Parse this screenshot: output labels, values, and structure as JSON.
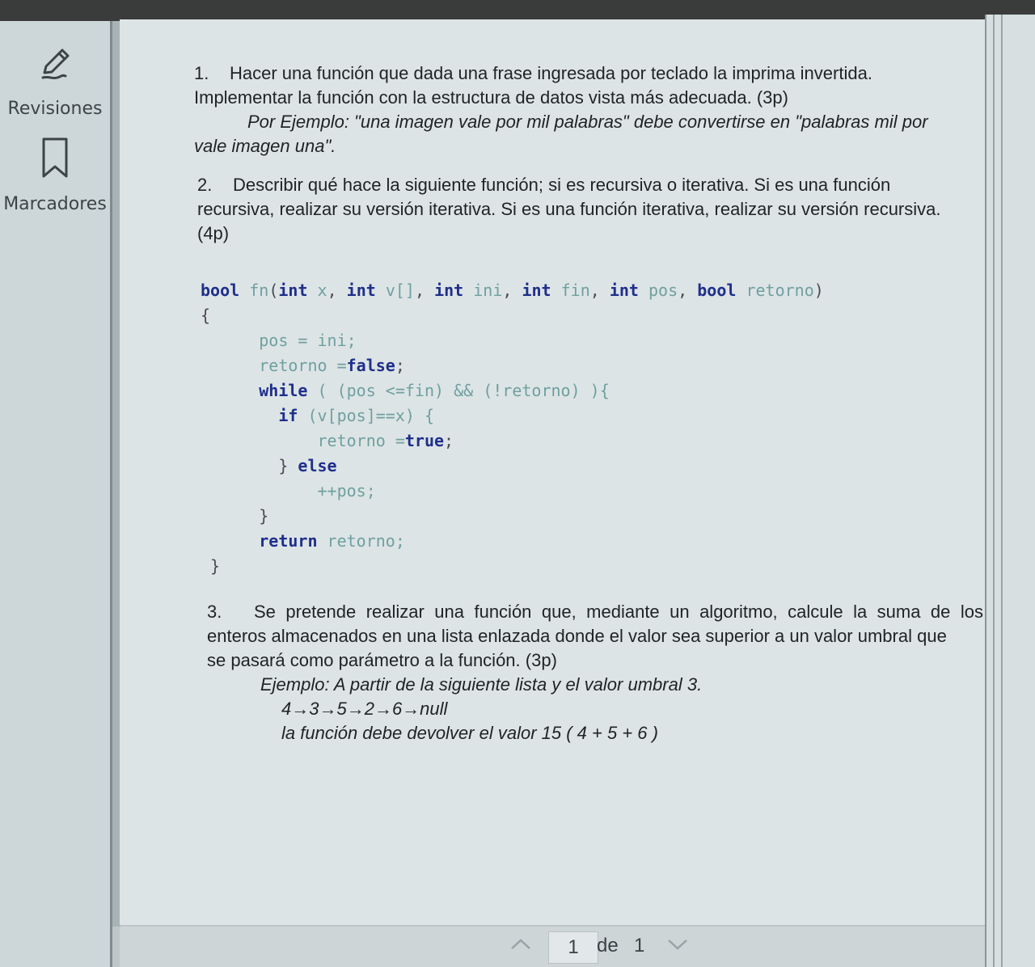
{
  "sidebar": {
    "items": [
      {
        "label": "Revisiones",
        "icon": "pencil-icon"
      },
      {
        "label": "Marcadores",
        "icon": "bookmark-icon"
      }
    ]
  },
  "document": {
    "q1": {
      "number": "1.",
      "line1": "Hacer una función que dada una frase ingresada por teclado la imprima invertida.",
      "line2": "Implementar la función con la estructura de datos vista más adecuada. (3p)",
      "example_line1": "Por Ejemplo: \"una imagen vale por mil palabras\" debe convertirse en \"palabras mil por",
      "example_line2": "vale imagen una\"."
    },
    "q2": {
      "number": "2.",
      "line1": "Describir qué hace la siguiente función; si es recursiva o iterativa. Si es una función",
      "line2": "recursiva, realizar su versión iterativa. Si es una función iterativa, realizar su versión recursiva.",
      "line3": "(4p)"
    },
    "code": {
      "signature": {
        "kw_bool": "bool",
        "fn": "fn",
        "open": "(",
        "kw_int": "int",
        "x": "x",
        "v": "v[]",
        "ini": "ini",
        "fin": "fin",
        "pos": "pos",
        "retorno": "retorno",
        "close": ")"
      },
      "open_brace": "{",
      "l_pos": "pos = ini;",
      "l_ret_a": "retorno =",
      "l_ret_b": "false",
      "l_while_kw": "while",
      "l_while_rest": " ( (pos <=fin) && (!retorno) ){",
      "l_if_kw": "if",
      "l_if_rest": " (v[pos]==x) {",
      "l_rt_a": "retorno =",
      "l_rt_b": "true",
      "l_else_a": "} ",
      "l_else_kw": "else",
      "l_inc": "++pos;",
      "l_close_inner": "}",
      "l_return_kw": "return",
      "l_return_rest": " retorno;",
      "close_brace": "}"
    },
    "q3": {
      "number": "3.",
      "line1": "Se pretende realizar una función que, mediante un algoritmo, calcule la suma de los",
      "line2": "enteros almacenados en una lista enlazada donde el valor sea superior a un valor umbral que",
      "line3": "se pasará como parámetro a la función. (3p)",
      "example_line1": "Ejemplo: A partir de la siguiente lista y el valor umbral 3.",
      "example_line2": "4→3→5→2→6→null",
      "example_line3": "la función debe devolver el valor 15 ( 4 + 5 + 6 )"
    }
  },
  "pager": {
    "current": "1",
    "of_label": "de",
    "total": "1",
    "prev_icon": "chevron-up-icon",
    "next_icon": "chevron-down-icon"
  }
}
